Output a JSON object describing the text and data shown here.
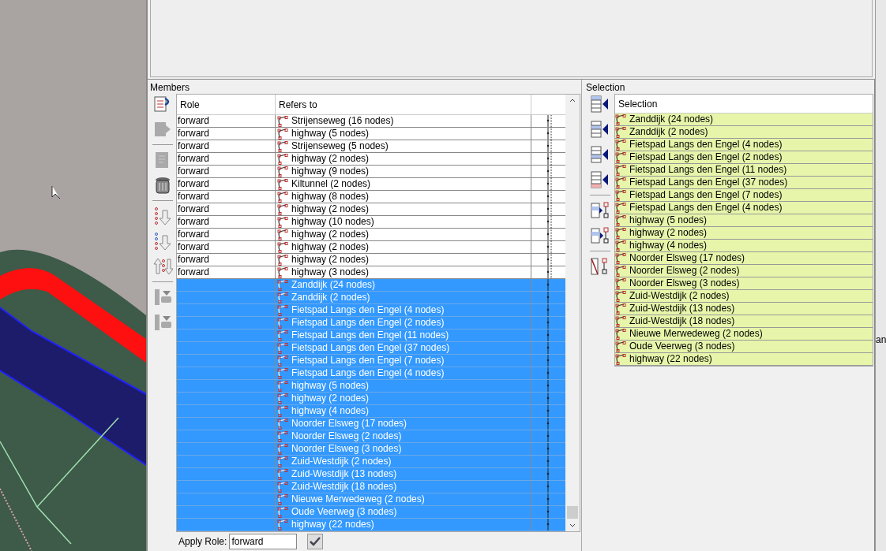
{
  "members": {
    "title": "Members",
    "columns": [
      "Role",
      "Refers to"
    ],
    "rows": [
      {
        "role": "forward",
        "refers_to": "Strijenseweg (16 nodes)",
        "selected": false
      },
      {
        "role": "forward",
        "refers_to": "highway (5 nodes)",
        "selected": false
      },
      {
        "role": "forward",
        "refers_to": "Strijenseweg (5 nodes)",
        "selected": false
      },
      {
        "role": "forward",
        "refers_to": "highway (2 nodes)",
        "selected": false
      },
      {
        "role": "forward",
        "refers_to": "highway (9 nodes)",
        "selected": false
      },
      {
        "role": "forward",
        "refers_to": "Kiltunnel (2 nodes)",
        "selected": false
      },
      {
        "role": "forward",
        "refers_to": "highway (8 nodes)",
        "selected": false
      },
      {
        "role": "forward",
        "refers_to": "highway (2 nodes)",
        "selected": false
      },
      {
        "role": "forward",
        "refers_to": "highway (10 nodes)",
        "selected": false
      },
      {
        "role": "forward",
        "refers_to": "highway (2 nodes)",
        "selected": false
      },
      {
        "role": "forward",
        "refers_to": "highway (2 nodes)",
        "selected": false
      },
      {
        "role": "forward",
        "refers_to": "highway (2 nodes)",
        "selected": false
      },
      {
        "role": "forward",
        "refers_to": "highway (3 nodes)",
        "selected": false
      },
      {
        "refers_to": "Zanddijk (24 nodes)",
        "selected": true
      },
      {
        "refers_to": "Zanddijk (2 nodes)",
        "selected": true
      },
      {
        "refers_to": "Fietspad Langs den Engel (4 nodes)",
        "selected": true
      },
      {
        "refers_to": "Fietspad Langs den Engel (2 nodes)",
        "selected": true
      },
      {
        "refers_to": "Fietspad Langs den Engel (11 nodes)",
        "selected": true
      },
      {
        "refers_to": "Fietspad Langs den Engel (37 nodes)",
        "selected": true
      },
      {
        "refers_to": "Fietspad Langs den Engel (7 nodes)",
        "selected": true
      },
      {
        "refers_to": "Fietspad Langs den Engel (4 nodes)",
        "selected": true
      },
      {
        "refers_to": "highway (5 nodes)",
        "selected": true
      },
      {
        "refers_to": "highway (2 nodes)",
        "selected": true
      },
      {
        "refers_to": "highway (4 nodes)",
        "selected": true
      },
      {
        "refers_to": "Noorder Elsweg (17 nodes)",
        "selected": true
      },
      {
        "refers_to": "Noorder Elsweg (2 nodes)",
        "selected": true
      },
      {
        "refers_to": "Noorder Elsweg (3 nodes)",
        "selected": true
      },
      {
        "refers_to": "Zuid-Westdijk (2 nodes)",
        "selected": true
      },
      {
        "refers_to": "Zuid-Westdijk (13 nodes)",
        "selected": true
      },
      {
        "refers_to": "Zuid-Westdijk (18 nodes)",
        "selected": true
      },
      {
        "refers_to": "Nieuwe Merwedeweg (2 nodes)",
        "selected": true
      },
      {
        "refers_to": "Oude Veerweg (3 nodes)",
        "selected": true
      },
      {
        "refers_to": "highway (22 nodes)",
        "selected": true
      }
    ],
    "apply_role": {
      "label": "Apply Role:",
      "value": "forward"
    }
  },
  "selection": {
    "title": "Selection",
    "column": "Selection",
    "items": [
      "Zanddijk (24 nodes)",
      "Zanddijk (2 nodes)",
      "Fietspad Langs den Engel (4 nodes)",
      "Fietspad Langs den Engel (2 nodes)",
      "Fietspad Langs den Engel (11 nodes)",
      "Fietspad Langs den Engel (37 nodes)",
      "Fietspad Langs den Engel (7 nodes)",
      "Fietspad Langs den Engel (4 nodes)",
      "highway (5 nodes)",
      "highway (2 nodes)",
      "highway (4 nodes)",
      "Noorder Elsweg (17 nodes)",
      "Noorder Elsweg (2 nodes)",
      "Noorder Elsweg (3 nodes)",
      "Zuid-Westdijk (2 nodes)",
      "Zuid-Westdijk (13 nodes)",
      "Zuid-Westdijk (18 nodes)",
      "Nieuwe Merwedeweg (2 nodes)",
      "Oude Veerweg (3 nodes)",
      "highway (22 nodes)"
    ]
  },
  "side_panel": {
    "text": "an"
  }
}
